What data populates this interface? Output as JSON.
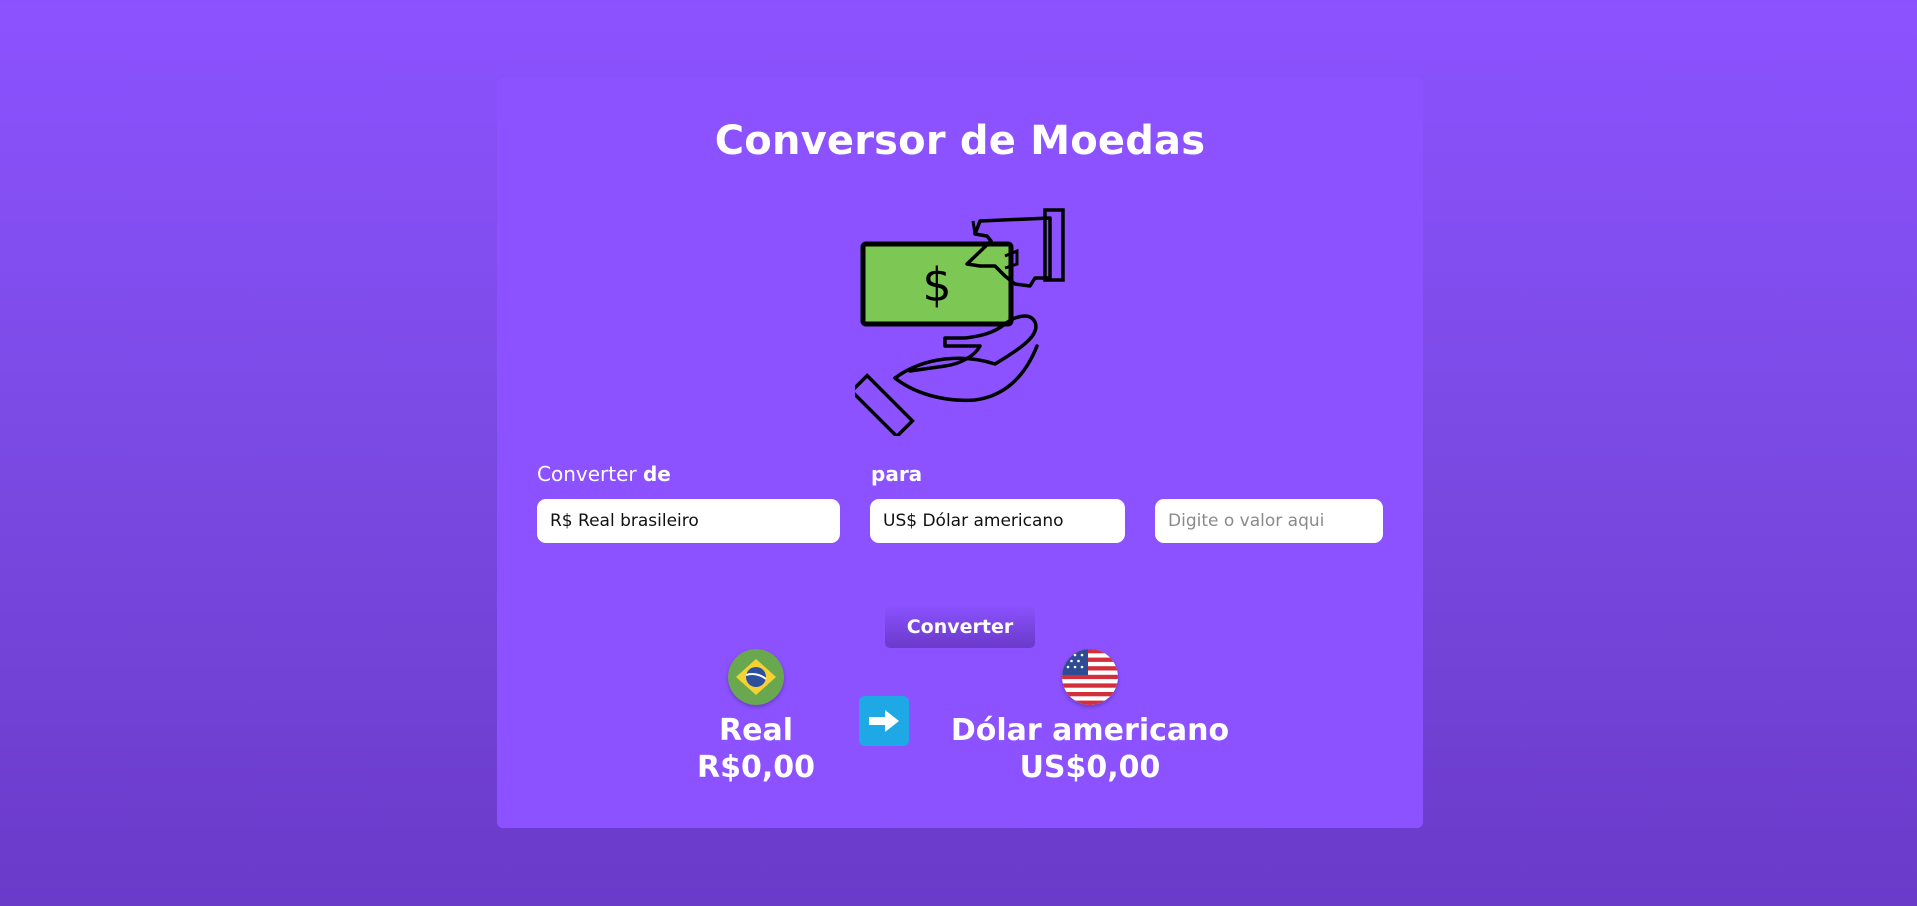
{
  "title": "Conversor de Moedas",
  "form": {
    "from_label_prefix": "Converter",
    "from_label_bold": "de",
    "to_label": "para",
    "from_value": "R$ Real brasileiro",
    "to_value": "US$ Dólar americano",
    "amount_placeholder": "Digite o valor aqui",
    "convert_label": "Converter"
  },
  "result": {
    "from_name": "Real",
    "from_value": "R$0,00",
    "to_name": "Dólar americano",
    "to_value": "US$0,00"
  },
  "icons": {
    "hero": "money-exchange-hands-icon",
    "from_flag": "brazil-flag-icon",
    "to_flag": "usa-flag-icon",
    "arrow": "arrow-right-icon"
  },
  "colors": {
    "background": "#8c52ff",
    "card": "#8c52ff",
    "money_green": "#7dc855",
    "arrow_bg": "#1ea8e6"
  }
}
